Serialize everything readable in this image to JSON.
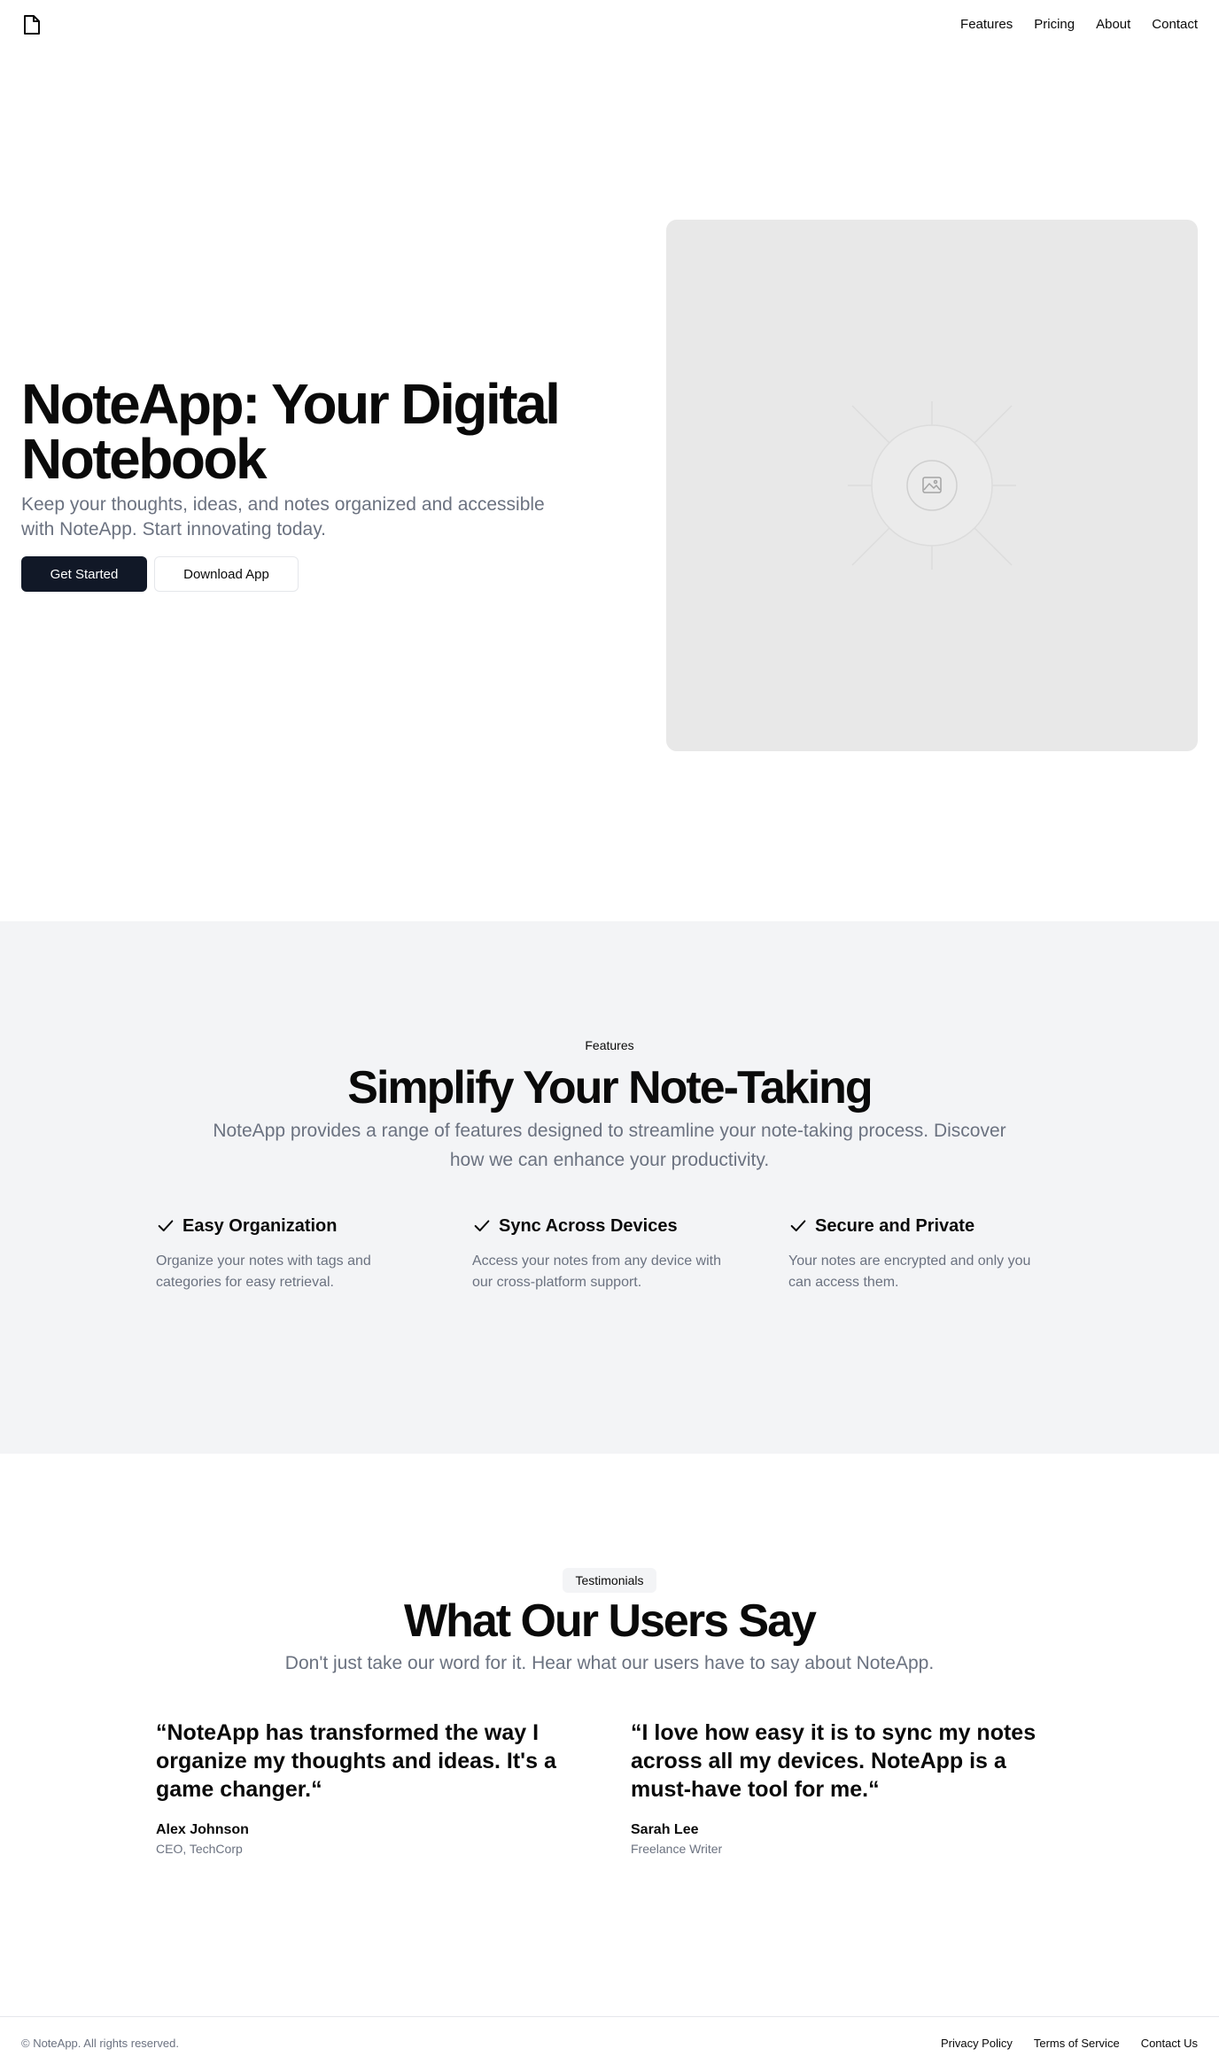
{
  "header": {
    "logo_icon": "file-icon",
    "nav": [
      "Features",
      "Pricing",
      "About",
      "Contact"
    ]
  },
  "hero": {
    "title": "NoteApp: Your Digital Notebook",
    "description": "Keep your thoughts, ideas, and notes organized and accessible with NoteApp. Start innovating today.",
    "primary_button": "Get Started",
    "secondary_button": "Download App",
    "image_icon": "image-placeholder-icon"
  },
  "features": {
    "eyebrow": "Features",
    "title": "Simplify Your Note-Taking",
    "description": "NoteApp provides a range of features designed to streamline your note-taking process. Discover how we can enhance your productivity.",
    "items": [
      {
        "title": "Easy Organization",
        "description": "Organize your notes with tags and categories for easy retrieval."
      },
      {
        "title": "Sync Across Devices",
        "description": "Access your notes from any device with our cross-platform support."
      },
      {
        "title": "Secure and Private",
        "description": "Your notes are encrypted and only you can access them."
      }
    ]
  },
  "testimonials": {
    "badge": "Testimonials",
    "title": "What Our Users Say",
    "description": "Don't just take our word for it. Hear what our users have to say about NoteApp.",
    "items": [
      {
        "quote": "“NoteApp has transformed the way I organize my thoughts and ideas. It's a game changer.“",
        "name": "Alex Johnson",
        "role": "CEO, TechCorp"
      },
      {
        "quote": "“I love how easy it is to sync my notes across all my devices. NoteApp is a must-have tool for me.“",
        "name": "Sarah Lee",
        "role": "Freelance Writer"
      }
    ]
  },
  "footer": {
    "copyright": "© NoteApp. All rights reserved.",
    "links": [
      "Privacy Policy",
      "Terms of Service",
      "Contact Us"
    ]
  },
  "colors": {
    "primary": "#111827",
    "muted_text": "#6b7280",
    "section_bg": "#f3f4f6",
    "image_bg": "#e8e8e8"
  }
}
